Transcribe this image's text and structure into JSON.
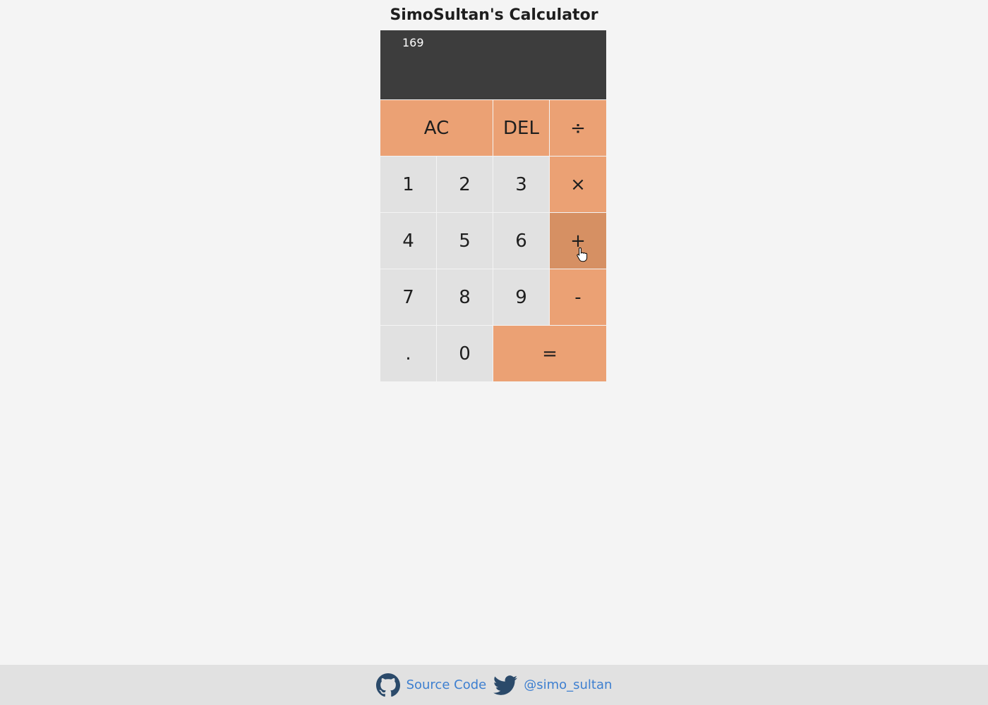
{
  "title": "SimoSultan's Calculator",
  "display": {
    "value": "169"
  },
  "keys": [
    {
      "label": "AC",
      "name": "ac-button",
      "type": "op",
      "span": 2
    },
    {
      "label": "DEL",
      "name": "del-button",
      "type": "op"
    },
    {
      "label": "÷",
      "name": "divide-button",
      "type": "op"
    },
    {
      "label": "1",
      "name": "digit-1-button",
      "type": "num"
    },
    {
      "label": "2",
      "name": "digit-2-button",
      "type": "num"
    },
    {
      "label": "3",
      "name": "digit-3-button",
      "type": "num"
    },
    {
      "label": "×",
      "name": "multiply-button",
      "type": "op"
    },
    {
      "label": "4",
      "name": "digit-4-button",
      "type": "num"
    },
    {
      "label": "5",
      "name": "digit-5-button",
      "type": "num"
    },
    {
      "label": "6",
      "name": "digit-6-button",
      "type": "num"
    },
    {
      "label": "+",
      "name": "add-button",
      "type": "op",
      "hover": true
    },
    {
      "label": "7",
      "name": "digit-7-button",
      "type": "num"
    },
    {
      "label": "8",
      "name": "digit-8-button",
      "type": "num"
    },
    {
      "label": "9",
      "name": "digit-9-button",
      "type": "num"
    },
    {
      "label": "-",
      "name": "subtract-button",
      "type": "op"
    },
    {
      "label": ".",
      "name": "decimal-button",
      "type": "num"
    },
    {
      "label": "0",
      "name": "digit-0-button",
      "type": "num"
    },
    {
      "label": "=",
      "name": "equals-button",
      "type": "op",
      "span": 2
    }
  ],
  "footer": {
    "source_label": "Source Code",
    "source_icon": "github-icon",
    "twitter_label": "@simo_sultan",
    "twitter_icon": "twitter-icon"
  },
  "colors": {
    "display_bg": "#3d3d3d",
    "operator_key": "#eba174",
    "operator_key_hover": "#d69063",
    "number_key": "#e1e1e1",
    "link": "#3d7fd0"
  }
}
